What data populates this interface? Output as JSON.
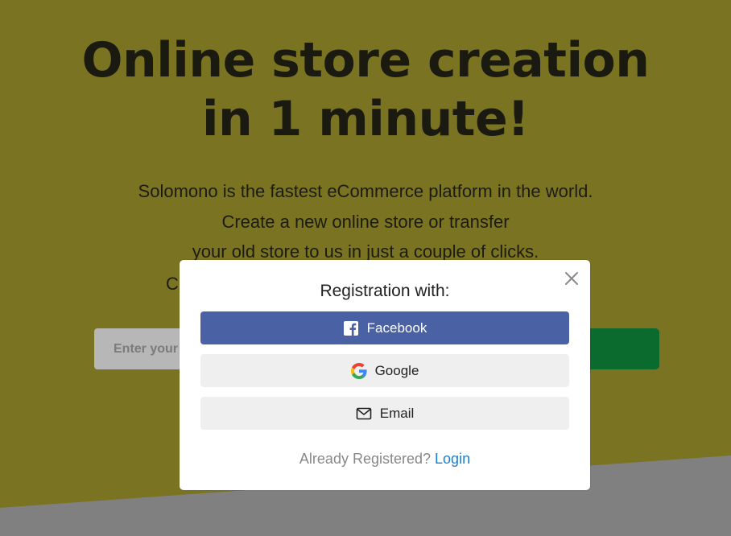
{
  "hero": {
    "title_line1": "Online store creation",
    "title_line2": "in 1 minute!",
    "subtitle_line1": "Solomono is the fastest eCommerce platform in the world.",
    "subtitle_line2": "Create a new online store or transfer",
    "subtitle_line3": "your old store to us in just a couple of clicks.",
    "subtitle_line4": "C",
    "email_placeholder": "Enter your e-mail"
  },
  "modal": {
    "title": "Registration with:",
    "close_icon": "close-icon",
    "options": [
      {
        "label": "Facebook",
        "icon": "facebook-icon",
        "bg": "#4a61a3"
      },
      {
        "label": "Google",
        "icon": "google-icon",
        "bg": "#efefef"
      },
      {
        "label": "Email",
        "icon": "envelope-icon",
        "bg": "#efefef"
      }
    ],
    "already_text": "Already Registered?",
    "login_label": "Login"
  },
  "colors": {
    "hero_bg": "#7a7321",
    "primary_green": "#0b6a2e",
    "facebook_blue": "#4a61a3",
    "link_blue": "#1a7fd0"
  }
}
